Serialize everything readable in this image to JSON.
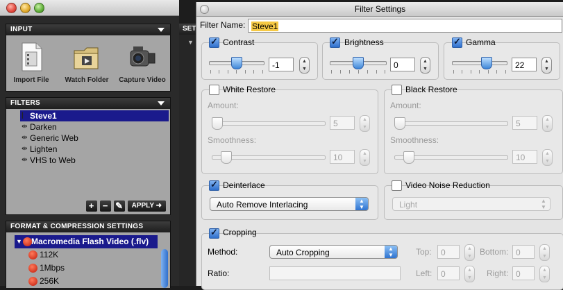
{
  "input_panel": {
    "title": "INPUT",
    "tools": [
      {
        "label": "Import File",
        "icon": "document-film-icon"
      },
      {
        "label": "Watch Folder",
        "icon": "folder-film-icon"
      },
      {
        "label": "Capture Video",
        "icon": "camcorder-icon"
      }
    ]
  },
  "behind_panel_label": "SET",
  "filters_panel": {
    "title": "FILTERS",
    "items": [
      "Steve1",
      "Darken",
      "Generic Web",
      "Lighten",
      "VHS to Web"
    ],
    "selected": "Steve1",
    "buttons": {
      "add": "+",
      "remove": "−",
      "edit": "✎",
      "apply": "APPLY ➜"
    }
  },
  "format_panel": {
    "title": "FORMAT & COMPRESSION SETTINGS",
    "format": "Macromedia Flash Video (.flv)",
    "presets": [
      "112K",
      "1Mbps",
      "256K"
    ]
  },
  "dialog": {
    "title": "Filter Settings",
    "filter_name_label": "Filter Name:",
    "filter_name_value": "Steve1",
    "contrast": {
      "label": "Contrast",
      "checked": true,
      "value": "-1",
      "level": 0.45
    },
    "brightness": {
      "label": "Brightness",
      "checked": true,
      "value": "0",
      "level": 0.5
    },
    "gamma": {
      "label": "Gamma",
      "checked": true,
      "value": "22",
      "level": 0.61
    },
    "white_restore": {
      "label": "White Restore",
      "checked": false,
      "amount_label": "Amount:",
      "amount": "5",
      "smoothness_label": "Smoothness:",
      "smoothness": "10"
    },
    "black_restore": {
      "label": "Black Restore",
      "checked": false,
      "amount_label": "Amount:",
      "amount": "5",
      "smoothness_label": "Smoothness:",
      "smoothness": "10"
    },
    "deinterlace": {
      "label": "Deinterlace",
      "checked": true,
      "option": "Auto Remove Interlacing"
    },
    "video_noise_reduction": {
      "label": "Video Noise Reduction",
      "checked": false,
      "option": "Light"
    },
    "cropping": {
      "label": "Cropping",
      "checked": true,
      "method_label": "Method:",
      "method": "Auto Cropping",
      "ratio_label": "Ratio:",
      "ratio": "",
      "top_label": "Top:",
      "top": "0",
      "bottom_label": "Bottom:",
      "bottom": "0",
      "left_label": "Left:",
      "left": "0",
      "right_label": "Right:",
      "right": "0"
    }
  },
  "colors": {
    "selection": "#1a1a8c",
    "accent": "#2f74d0",
    "panel": "#a5a5a5",
    "name_highlight": "#f6c944"
  }
}
